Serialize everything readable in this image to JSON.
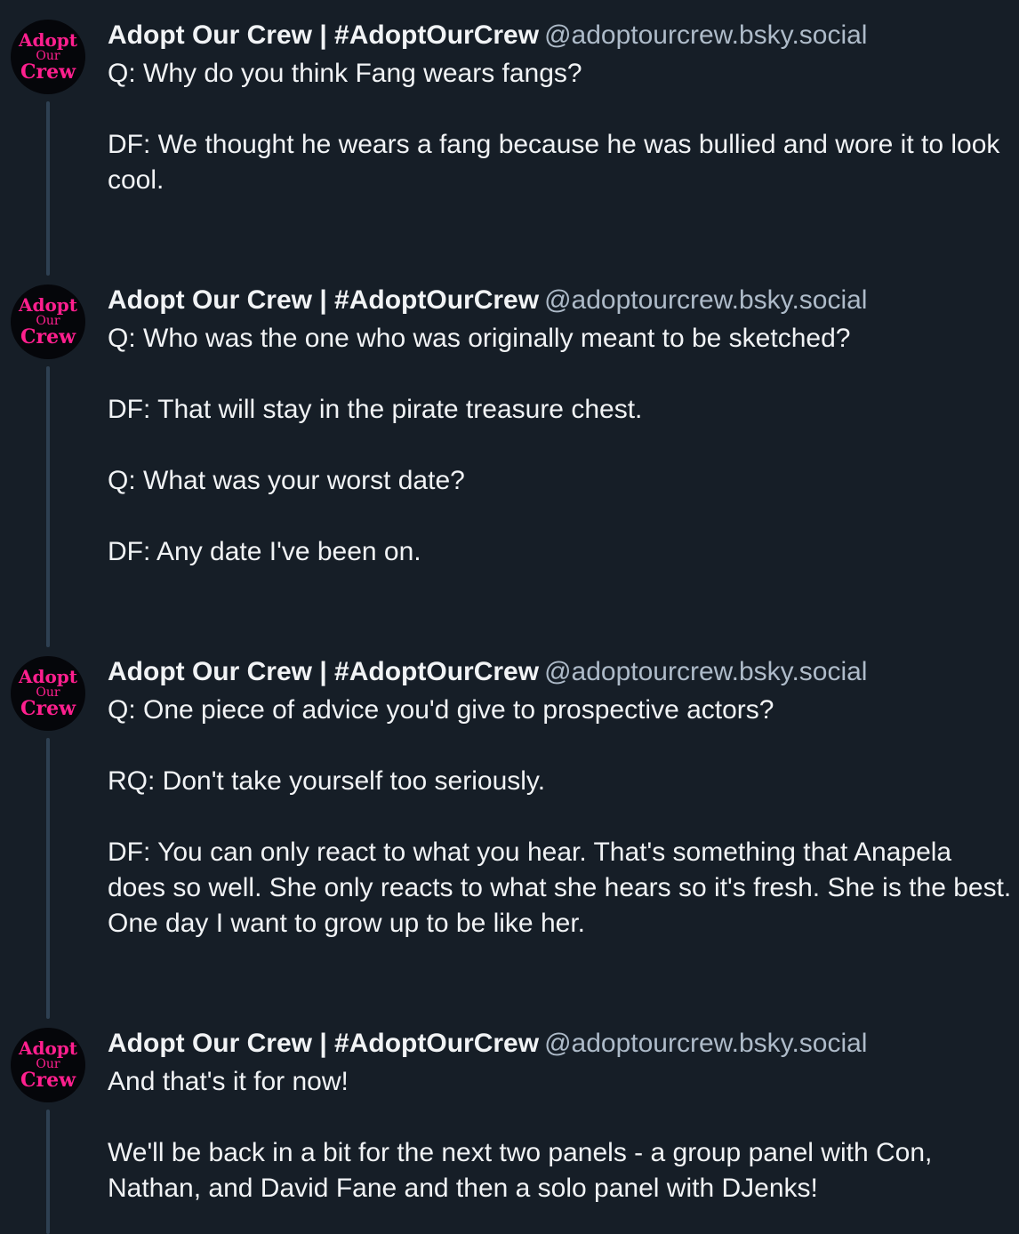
{
  "author": {
    "display_name": "Adopt Our Crew | #AdoptOurCrew",
    "handle": "@adoptourcrew.bsky.social",
    "avatar_text": [
      "Adopt",
      "Our",
      "Crew"
    ],
    "avatar_color": "#ff1f8e"
  },
  "posts": [
    {
      "paragraphs": [
        "Q: Why do you think Fang wears fangs?",
        "DF: We thought he wears a fang because he was bullied and wore it to look cool."
      ]
    },
    {
      "paragraphs": [
        "Q: Who was the one who was originally meant to be sketched?",
        "DF: That will stay in the pirate treasure chest.",
        "Q: What was your worst date?",
        "DF: Any date I've been on."
      ]
    },
    {
      "paragraphs": [
        "Q: One piece of advice you'd give to prospective actors?",
        "RQ: Don't take yourself too seriously.",
        "DF: You can only react to what you hear. That's something that Anapela does so well. She only reacts to what she hears so it's fresh. She is the best. One day I want to grow up to be like her."
      ]
    },
    {
      "paragraphs": [
        "And that's it for now!",
        "We'll be back in a bit for the next two panels - a group panel with Con, Nathan, and David Fane and then a solo panel with DJenks!"
      ]
    }
  ],
  "colors": {
    "background": "#161e27",
    "text": "#f1f3f5",
    "handle": "#aebbc9",
    "thread_line": "#2e4052"
  }
}
